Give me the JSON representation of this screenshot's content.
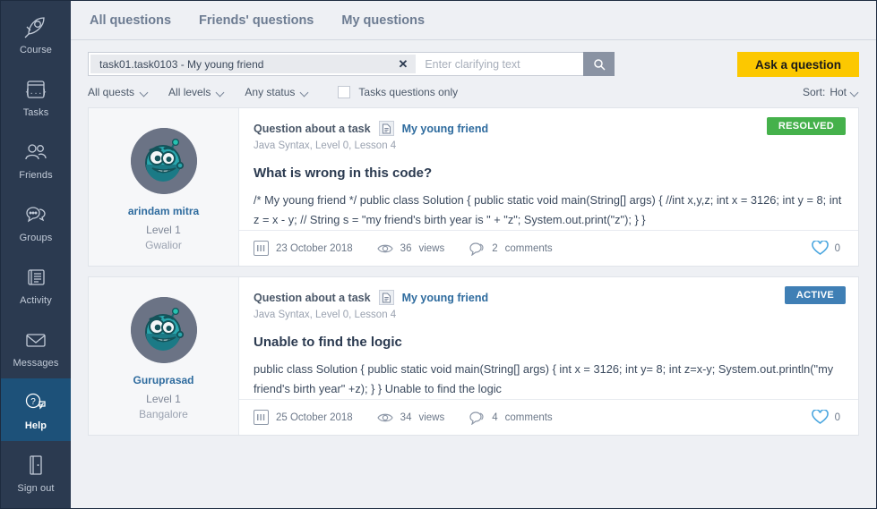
{
  "sidebar": {
    "items": [
      {
        "label": "Course",
        "icon": "rocket-icon",
        "active": false
      },
      {
        "label": "Tasks",
        "icon": "code-icon",
        "active": false
      },
      {
        "label": "Friends",
        "icon": "people-icon",
        "active": false
      },
      {
        "label": "Groups",
        "icon": "chat-icon",
        "active": false
      },
      {
        "label": "Activity",
        "icon": "news-icon",
        "active": false
      },
      {
        "label": "Messages",
        "icon": "envelope-icon",
        "active": false
      },
      {
        "label": "Help",
        "icon": "help-chat-icon",
        "active": true
      },
      {
        "label": "Sign out",
        "icon": "door-icon",
        "active": false
      }
    ]
  },
  "tabs": [
    {
      "label": "All questions"
    },
    {
      "label": "Friends' questions"
    },
    {
      "label": "My questions"
    }
  ],
  "search": {
    "chip_label": "task01.task0103 - My young friend",
    "chip_close": "✕",
    "placeholder": "Enter clarifying text",
    "value": "",
    "button_icon": "search-icon"
  },
  "ask_button": {
    "label": "Ask a question"
  },
  "filters": {
    "quests": "All quests",
    "levels": "All levels",
    "status": "Any status",
    "tasks_only_label": "Tasks questions only",
    "tasks_only_checked": false,
    "sort_label": "Sort:",
    "sort_value": "Hot"
  },
  "colors": {
    "accent_yellow": "#fcc800",
    "badge_resolved": "#45b14b",
    "badge_active": "#3f7fb5",
    "sidebar_bg": "#2b3a50",
    "sidebar_active": "#1d5179",
    "link_blue": "#2e6b9e"
  },
  "questions": [
    {
      "user": {
        "name": "arindam mitra",
        "level": "Level 1",
        "city": "Gwalior"
      },
      "kind": "Question about a task",
      "task_name": "My young friend",
      "course_meta": "Java Syntax, Level 0, Lesson 4",
      "title": "What is wrong in this code?",
      "body": "/* My young friend */ public class Solution { public static void main(String[] args) { //int x,y,z; int x = 3126; int y = 8; int z = x - y; // String s = \"my friend's birth year is \" + \"z\"; System.out.print(\"z\"); } }",
      "status": "RESOLVED",
      "status_kind": "resolved",
      "date": "23 October 2018",
      "views": "36",
      "views_label": "views",
      "comments": "2",
      "comments_label": "comments",
      "likes": "0"
    },
    {
      "user": {
        "name": "Guruprasad",
        "level": "Level 1",
        "city": "Bangalore"
      },
      "kind": "Question about a task",
      "task_name": "My young friend",
      "course_meta": "Java Syntax, Level 0, Lesson 4",
      "title": "Unable to find the logic",
      "body": "public class Solution { public static void main(String[] args) { int x = 3126; int y= 8; int z=x-y; System.out.println(\"my friend's birth year\" +z); } } Unable to find the logic",
      "status": "ACTIVE",
      "status_kind": "active",
      "date": "25 October 2018",
      "views": "34",
      "views_label": "views",
      "comments": "4",
      "comments_label": "comments",
      "likes": "0"
    }
  ]
}
